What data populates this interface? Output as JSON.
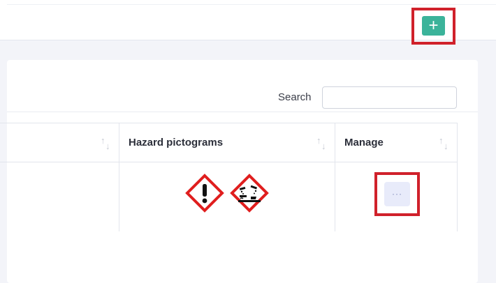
{
  "toolbar": {
    "add_label": "+"
  },
  "search": {
    "label": "Search",
    "value": "",
    "placeholder": ""
  },
  "table": {
    "columns": [
      {
        "label": ""
      },
      {
        "label": "Hazard pictograms"
      },
      {
        "label": "Manage"
      }
    ],
    "rows": [
      {
        "pictograms": [
          "exclamation-mark-icon",
          "corrosion-icon"
        ],
        "manage_label": "···"
      }
    ]
  },
  "colors": {
    "accent": "#3bb39a",
    "highlight": "#d0212b",
    "ghs_red": "#e01e1e",
    "manage_button_bg": "#e8ebfa"
  }
}
